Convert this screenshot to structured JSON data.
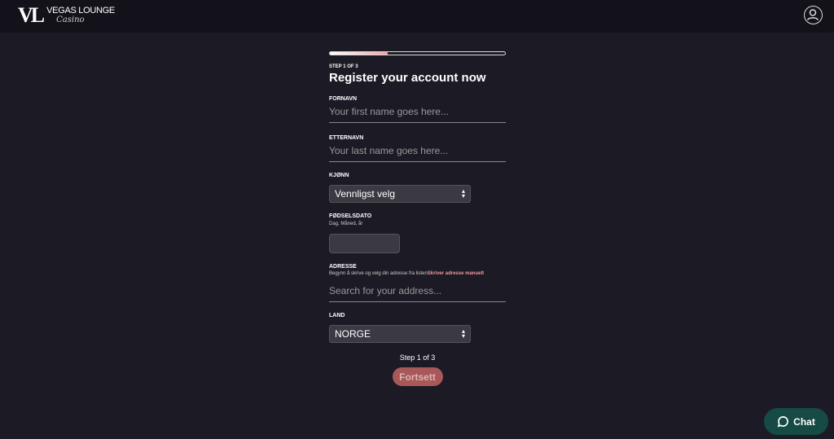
{
  "header": {
    "logo_mark": "VL",
    "logo_line1": "VEGAS LOUNGE",
    "logo_line2": "Casino",
    "user_icon": "user-circle-icon"
  },
  "form": {
    "progress_percent": 33,
    "step_small": "STEP 1 OF 3",
    "title": "Register your account now",
    "first_name": {
      "label": "FORNAVN",
      "placeholder": "Your first name goes here...",
      "value": ""
    },
    "last_name": {
      "label": "ETTERNAVN",
      "placeholder": "Your last name goes here...",
      "value": ""
    },
    "gender": {
      "label": "KJØNN",
      "selected": "Vennligst velg"
    },
    "birthdate": {
      "label": "FØDSELSDATO",
      "hint": "Dag, Måned, år",
      "value": ""
    },
    "address": {
      "label": "ADRESSE",
      "hint": "Begynn å skrive og velg din adresse fra listen",
      "manual_link": "Skriver adresse manuelt",
      "placeholder": "Search for your address...",
      "value": ""
    },
    "country": {
      "label": "LAND",
      "selected": "NORGE"
    },
    "step_text": "Step 1 of 3",
    "continue_label": "Fortsett"
  },
  "chat": {
    "label": "Chat",
    "icon": "chat-bubble-icon"
  },
  "colors": {
    "accent": "#f09a9a",
    "button": "#a85858",
    "chat": "#164a44",
    "background": "#1c1b25"
  }
}
